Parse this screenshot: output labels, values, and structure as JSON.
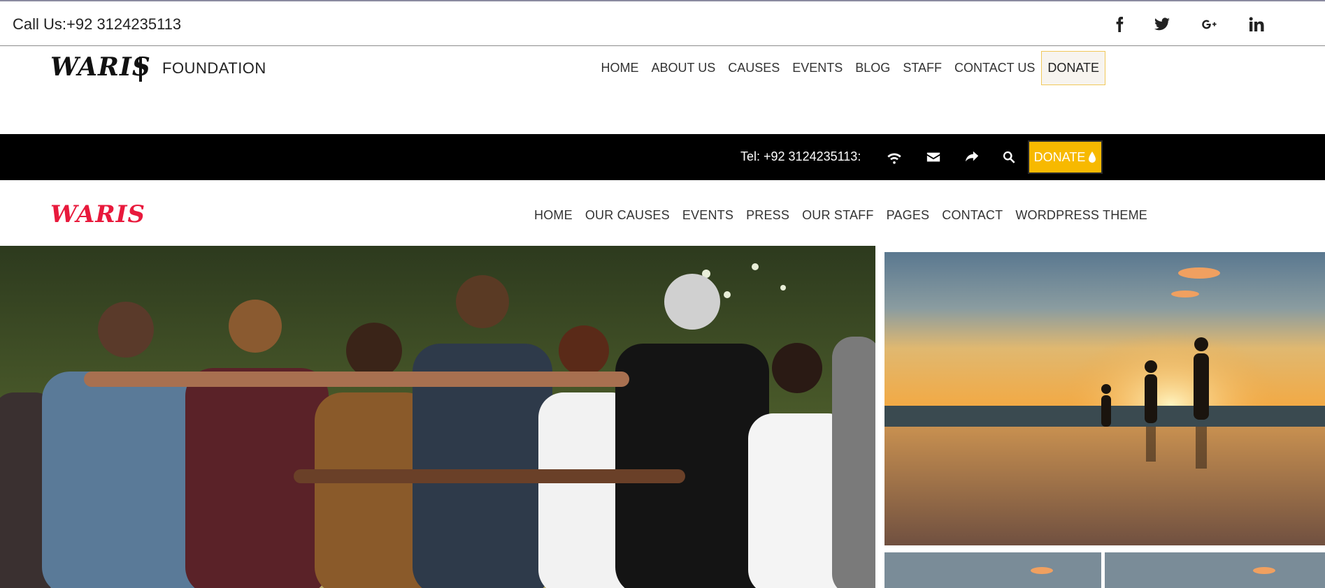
{
  "topbar": {
    "call": "Call Us:+92 3124235113",
    "social_icons": [
      "facebook-icon",
      "twitter-icon",
      "google-plus-icon",
      "linkedin-icon"
    ]
  },
  "header1": {
    "logo": "WARIS",
    "logo_sub": "FOUNDATION",
    "nav": [
      "HOME",
      "ABOUT US",
      "CAUSES",
      "EVENTS",
      "BLOG",
      "STAFF",
      "CONTACT US"
    ],
    "donate": "DONATE"
  },
  "blackbar": {
    "tel": "Tel: +92 3124235113:",
    "icons": [
      "wifi-icon",
      "envelope-icon",
      "share-icon",
      "search-icon"
    ],
    "donate": "DONATE"
  },
  "header2": {
    "logo": "WARIS",
    "nav": [
      "HOME",
      "OUR CAUSES",
      "EVENTS",
      "PRESS",
      "OUR STAFF",
      "PAGES",
      "CONTACT",
      "WORDPRESS THEME"
    ]
  },
  "colors": {
    "brand_red": "#e8193c",
    "donate_yellow": "#f7b900",
    "bar_black": "#000000"
  },
  "images": {
    "hero": "group-of-people-hugging-photo",
    "main_side": "family-beach-sunset-photo",
    "thumbs": [
      "sunset-thumbnail",
      "sunset-thumbnail"
    ]
  }
}
